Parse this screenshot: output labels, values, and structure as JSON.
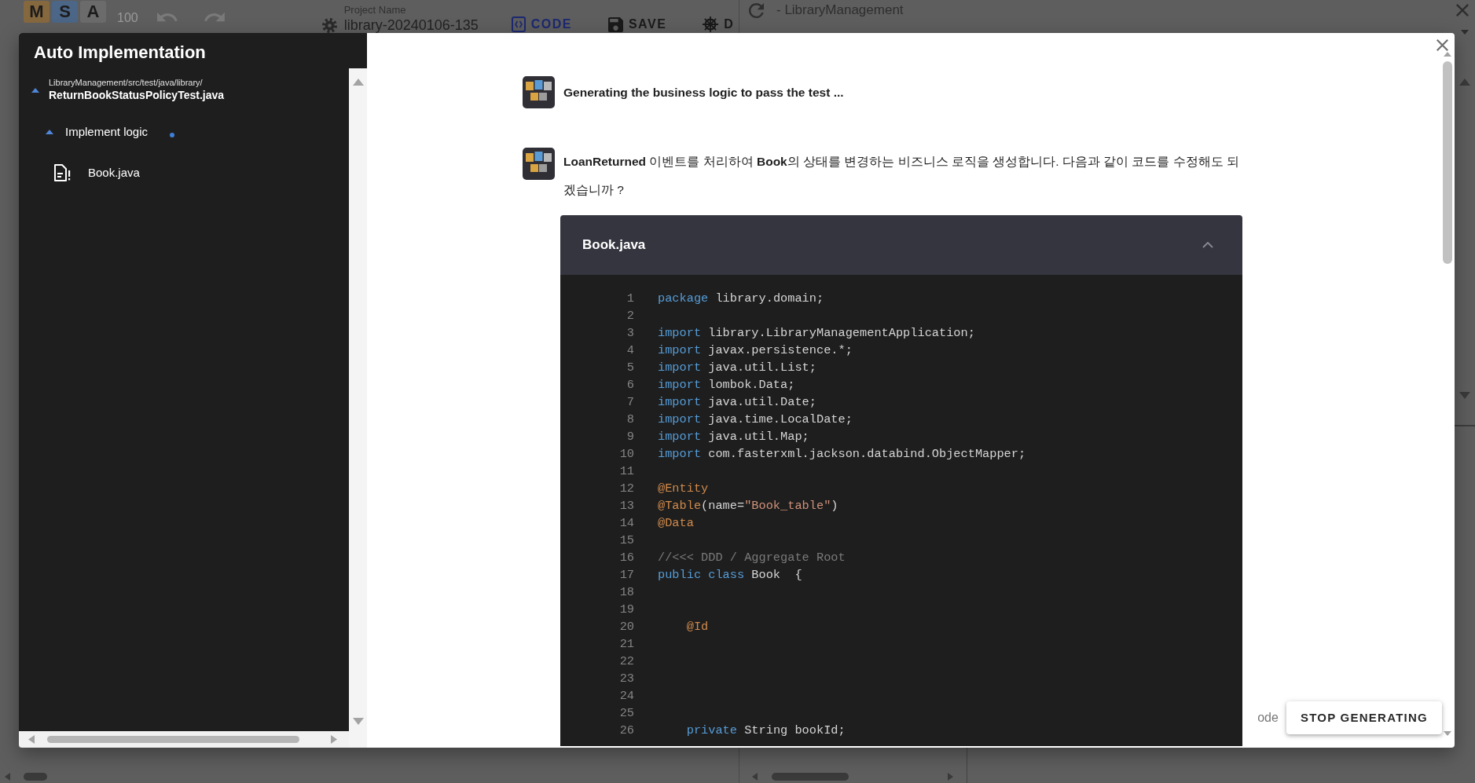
{
  "app_bar": {
    "logo": [
      {
        "letter": "M",
        "color": "#86683f"
      },
      {
        "letter": "S",
        "color": "#4b6686"
      },
      {
        "letter": "A",
        "color": "#6b6b6b"
      }
    ],
    "zoom": "100",
    "undo": {
      "disabled": true
    },
    "redo": {
      "disabled": true
    },
    "project": {
      "label": "Project Name",
      "value": "library-20240106-135"
    },
    "actions": [
      {
        "kind": "code",
        "label": "CODE"
      },
      {
        "kind": "save",
        "label": "SAVE"
      },
      {
        "kind": "deploy",
        "label": "D"
      }
    ]
  },
  "side_panel": {
    "title": "- LibraryManagement"
  },
  "dialog": {
    "sidebar": {
      "title": "Auto Implementation",
      "tree": [
        {
          "path": "LibraryManagement/src/test/java/library/",
          "label": "ReturnBookStatusPolicyTest.java",
          "expanded": true,
          "children": [
            {
              "label": "Implement logic",
              "expanded": true,
              "loading": true,
              "children": [
                {
                  "label": "Book.java",
                  "kind": "file"
                }
              ]
            }
          ]
        }
      ]
    },
    "messages": [
      {
        "kind": "status",
        "text": "Generating the business logic to pass the test ..."
      },
      {
        "kind": "proposal",
        "text": "**LoanReturned** 이벤트를 처리하여 **Book**의 상태를 변경하는 비즈니스 로직을 생성합니다. 다음과 같이 코드를 수정해도 되겠습니까 ?"
      }
    ],
    "code_panel": {
      "filename": "Book.java",
      "expanded": true,
      "lines": [
        {
          "number": "1",
          "tokens": [
            {
              "text": "package",
              "kind": "keyword"
            },
            {
              "text": " library.domain;",
              "kind": "plain"
            }
          ]
        },
        {
          "number": "2"
        },
        {
          "number": "3",
          "tokens": [
            {
              "text": "import",
              "kind": "keyword"
            },
            {
              "text": " library.LibraryManagementApplication;",
              "kind": "plain"
            }
          ]
        },
        {
          "number": "4",
          "tokens": [
            {
              "text": "import",
              "kind": "keyword"
            },
            {
              "text": " javax.persistence.*;",
              "kind": "plain"
            }
          ]
        },
        {
          "number": "5",
          "tokens": [
            {
              "text": "import",
              "kind": "keyword"
            },
            {
              "text": " java.util.List;",
              "kind": "plain"
            }
          ]
        },
        {
          "number": "6",
          "tokens": [
            {
              "text": "import",
              "kind": "keyword"
            },
            {
              "text": " lombok.Data;",
              "kind": "plain"
            }
          ]
        },
        {
          "number": "7",
          "tokens": [
            {
              "text": "import",
              "kind": "keyword"
            },
            {
              "text": " java.util.Date;",
              "kind": "plain"
            }
          ]
        },
        {
          "number": "8",
          "tokens": [
            {
              "text": "import",
              "kind": "keyword"
            },
            {
              "text": " java.time.LocalDate;",
              "kind": "plain"
            }
          ]
        },
        {
          "number": "9",
          "tokens": [
            {
              "text": "import",
              "kind": "keyword"
            },
            {
              "text": " java.util.Map;",
              "kind": "plain"
            }
          ]
        },
        {
          "number": "10",
          "tokens": [
            {
              "text": "import",
              "kind": "keyword"
            },
            {
              "text": " com.fasterxml.jackson.databind.ObjectMapper;",
              "kind": "plain"
            }
          ]
        },
        {
          "number": "11"
        },
        {
          "number": "12",
          "tokens": [
            {
              "text": "@Entity",
              "kind": "annotation"
            }
          ]
        },
        {
          "number": "13",
          "tokens": [
            {
              "text": "@Table",
              "kind": "annotation"
            },
            {
              "text": "(name=",
              "kind": "plain"
            },
            {
              "text": "\"Book_table\"",
              "kind": "string"
            },
            {
              "text": ")",
              "kind": "plain"
            }
          ]
        },
        {
          "number": "14",
          "tokens": [
            {
              "text": "@Data",
              "kind": "annotation"
            }
          ]
        },
        {
          "number": "15"
        },
        {
          "number": "16",
          "tokens": [
            {
              "text": "//<<< DDD / Aggregate Root",
              "kind": "comment"
            }
          ]
        },
        {
          "number": "17",
          "tokens": [
            {
              "text": "public",
              "kind": "keyword"
            },
            {
              "text": " class",
              "kind": "keyword"
            },
            {
              "text": " Book  {",
              "kind": "plain"
            }
          ]
        },
        {
          "number": "18"
        },
        {
          "number": "19"
        },
        {
          "number": "20",
          "tokens": [
            {
              "text": "    @Id",
              "kind": "annotation"
            }
          ]
        },
        {
          "number": "21"
        },
        {
          "number": "22"
        },
        {
          "number": "23"
        },
        {
          "number": "24"
        },
        {
          "number": "25"
        },
        {
          "number": "26",
          "tokens": [
            {
              "text": "    private",
              "kind": "keyword"
            },
            {
              "text": " String bookId;",
              "kind": "plain"
            }
          ]
        }
      ]
    },
    "footer": {
      "partial_label": "ode",
      "stop_button": "STOP GENERATING"
    }
  }
}
